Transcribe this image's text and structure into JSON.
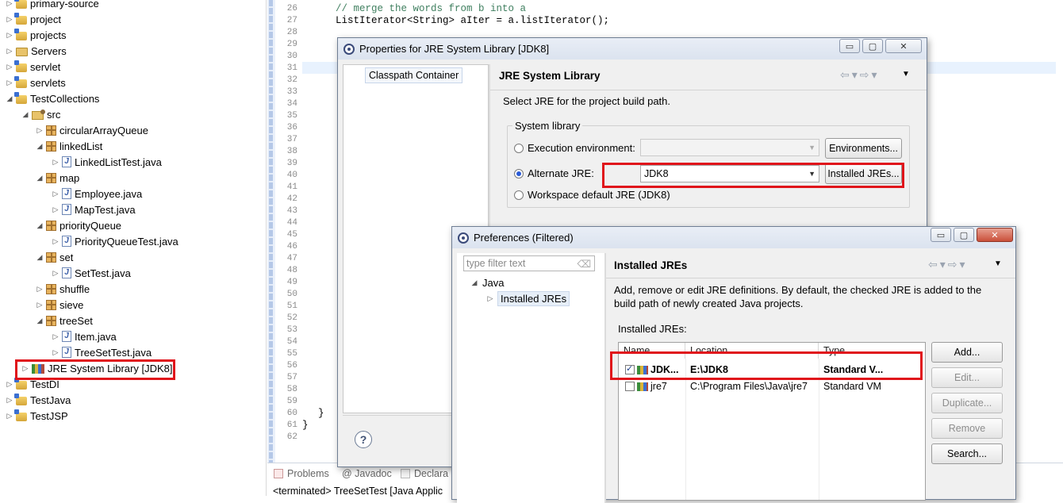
{
  "explorer": {
    "items": [
      {
        "label": "primary-source",
        "icon": "project-icon",
        "twisty": "▷"
      },
      {
        "label": "project",
        "icon": "project-icon",
        "twisty": "▷"
      },
      {
        "label": "projects",
        "icon": "project-icon",
        "twisty": "▷"
      },
      {
        "label": "Servers",
        "icon": "folder-icon",
        "twisty": "▷"
      },
      {
        "label": "servlet",
        "icon": "project-icon",
        "twisty": "▷"
      },
      {
        "label": "servlets",
        "icon": "project-icon",
        "twisty": "▷"
      },
      {
        "label": "TestCollections",
        "icon": "project-icon",
        "twisty": "◢"
      },
      {
        "label": "src",
        "icon": "source-folder-icon",
        "twisty": "◢"
      },
      {
        "label": "circularArrayQueue",
        "icon": "package-icon",
        "twisty": "▷"
      },
      {
        "label": "linkedList",
        "icon": "package-icon",
        "twisty": "◢"
      },
      {
        "label": "LinkedListTest.java",
        "icon": "java-file-icon",
        "twisty": "▷"
      },
      {
        "label": "map",
        "icon": "package-icon",
        "twisty": "◢"
      },
      {
        "label": "Employee.java",
        "icon": "java-file-icon",
        "twisty": "▷"
      },
      {
        "label": "MapTest.java",
        "icon": "java-file-icon",
        "twisty": "▷"
      },
      {
        "label": "priorityQueue",
        "icon": "package-icon",
        "twisty": "◢"
      },
      {
        "label": "PriorityQueueTest.java",
        "icon": "java-file-icon",
        "twisty": "▷"
      },
      {
        "label": "set",
        "icon": "package-icon",
        "twisty": "◢"
      },
      {
        "label": "SetTest.java",
        "icon": "java-file-icon",
        "twisty": "▷"
      },
      {
        "label": "shuffle",
        "icon": "package-icon",
        "twisty": "▷"
      },
      {
        "label": "sieve",
        "icon": "package-icon",
        "twisty": "▷"
      },
      {
        "label": "treeSet",
        "icon": "package-icon",
        "twisty": "◢"
      },
      {
        "label": "Item.java",
        "icon": "java-file-icon",
        "twisty": "▷"
      },
      {
        "label": "TreeSetTest.java",
        "icon": "java-file-icon",
        "twisty": "▷"
      },
      {
        "label": "JRE System Library [JDK8]",
        "icon": "library-icon",
        "twisty": "▷"
      },
      {
        "label": "TestDI",
        "icon": "project-icon",
        "twisty": "▷"
      },
      {
        "label": "TestJava",
        "icon": "project-icon",
        "twisty": "▷"
      },
      {
        "label": "TestJSP",
        "icon": "project-icon",
        "twisty": "▷"
      }
    ]
  },
  "editor": {
    "line_numbers": [
      "26",
      "27",
      "28",
      "29",
      "30",
      "31",
      "32",
      "33",
      "34",
      "35",
      "36",
      "37",
      "38",
      "39",
      "40",
      "41",
      "42",
      "43",
      "44",
      "45",
      "46",
      "47",
      "48",
      "49",
      "50",
      "51",
      "52",
      "53",
      "54",
      "55",
      "56",
      "57",
      "58",
      "59",
      "60",
      "61",
      "62"
    ],
    "code_comment": "// merge the words from b into a",
    "code_line_27": "ListIterator<String> aIter = a.listIterator();",
    "code_line_60": "}",
    "code_line_61": "}"
  },
  "bottom_views": {
    "tabs": [
      "Problems",
      "@ Javadoc",
      "Declara"
    ],
    "console_text": "<terminated> TreeSetTest [Java Applic"
  },
  "properties_dialog": {
    "title": "Properties for JRE System Library [JDK8]",
    "nav_item": "Classpath Container",
    "page_title": "JRE System Library",
    "description": "Select JRE for the project build path.",
    "group_label": "System library",
    "option_execution_env": "Execution environment:",
    "environments_button": "Environments...",
    "option_alternate_jre": "Alternate JRE:",
    "alternate_jre_value": "JDK8",
    "installed_jres_button": "Installed JREs...",
    "option_workspace_default": "Workspace default JRE (JDK8)",
    "help_symbol": "?",
    "selected_option": "alternate"
  },
  "preferences_dialog": {
    "title": "Preferences (Filtered)",
    "filter_placeholder": "type filter text",
    "tree_root": "Java",
    "tree_child": "Installed JREs",
    "page_title": "Installed JREs",
    "description": "Add, remove or edit JRE definitions. By default, the checked JRE is added to the build path of newly created Java projects.",
    "table_label": "Installed JREs:",
    "columns": [
      "Name",
      "Location",
      "Type"
    ],
    "rows": [
      {
        "name": "JDK...",
        "location": "E:\\JDK8",
        "type": "Standard V...",
        "checked": true
      },
      {
        "name": "jre7",
        "location": "C:\\Program Files\\Java\\jre7",
        "type": "Standard VM",
        "checked": false
      }
    ],
    "buttons": {
      "add": "Add...",
      "edit": "Edit...",
      "duplicate": "Duplicate...",
      "remove": "Remove",
      "search": "Search..."
    }
  },
  "colors": {
    "highlight_red": "#e0141b",
    "dialog_bg": "#f0f0f0",
    "comment_green": "#3f7f5f"
  }
}
